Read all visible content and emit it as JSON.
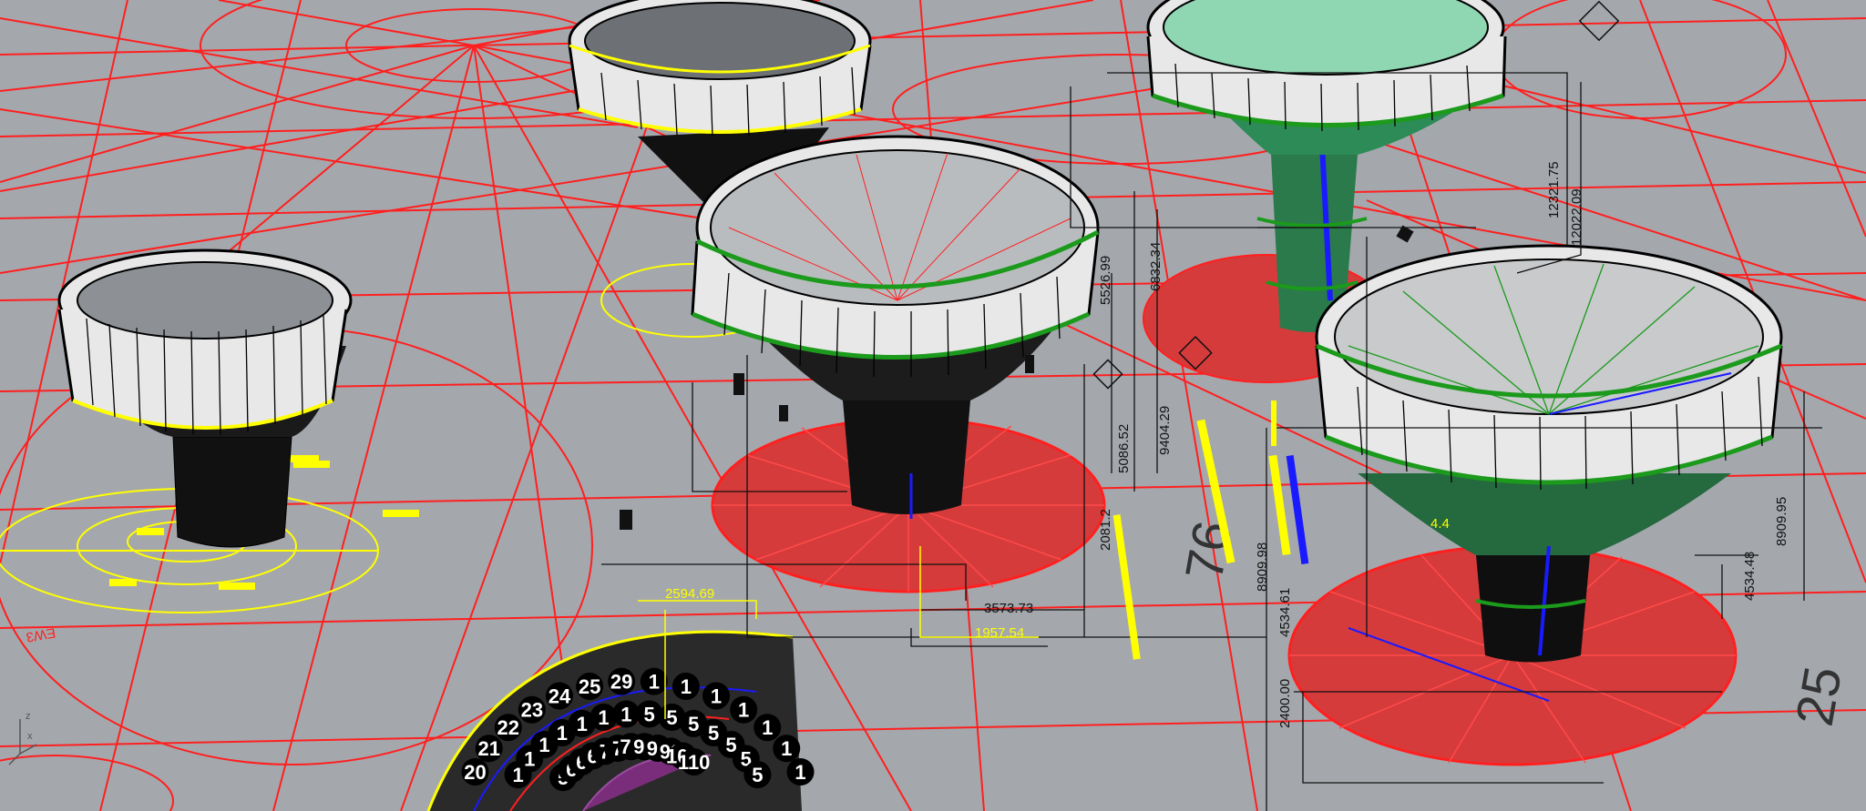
{
  "viewport": {
    "name": "Perspective",
    "background": "#a4a8ad",
    "grid_color": "#ff1f1f"
  },
  "colors": {
    "grid": "#ff1f1f",
    "selection": "#ffff00",
    "edge": "#1b9a1b",
    "accent": "#1a1aff",
    "panel": "#e8e8e8",
    "outline": "#000000"
  },
  "dimensions": {
    "d_2594": "2594.69",
    "d_3573": "3573.73",
    "d_1957": "1957.54",
    "d_5086": "5086.52",
    "d_9404": "9404.29",
    "d_2081": "2081.2",
    "d_6832": "6832.34",
    "d_5526": "5526.99",
    "d_8909a": "8909.98",
    "d_4534a": "4534.61",
    "d_2400": "2400.00",
    "d_8909b": "8909.95",
    "d_4534b": "4534.48",
    "d_12321": "12321.75",
    "d_12022": "12022.09",
    "d_4": "4.4",
    "big_76": "76",
    "big_25": "25",
    "left_label": "EW3"
  },
  "numbered_markers": [
    "20",
    "21",
    "22",
    "23",
    "24",
    "25",
    "29",
    "1",
    "1",
    "1",
    "1",
    "1",
    "1",
    "1",
    "1",
    "1",
    "1",
    "1",
    "1",
    "1",
    "1",
    "5",
    "5",
    "5",
    "5",
    "5",
    "5",
    "5",
    "5",
    "6",
    "6",
    "6",
    "7",
    "7",
    "79",
    "90",
    "91",
    "92",
    "108",
    "110"
  ],
  "axis": {
    "z": "z",
    "x": "x"
  }
}
